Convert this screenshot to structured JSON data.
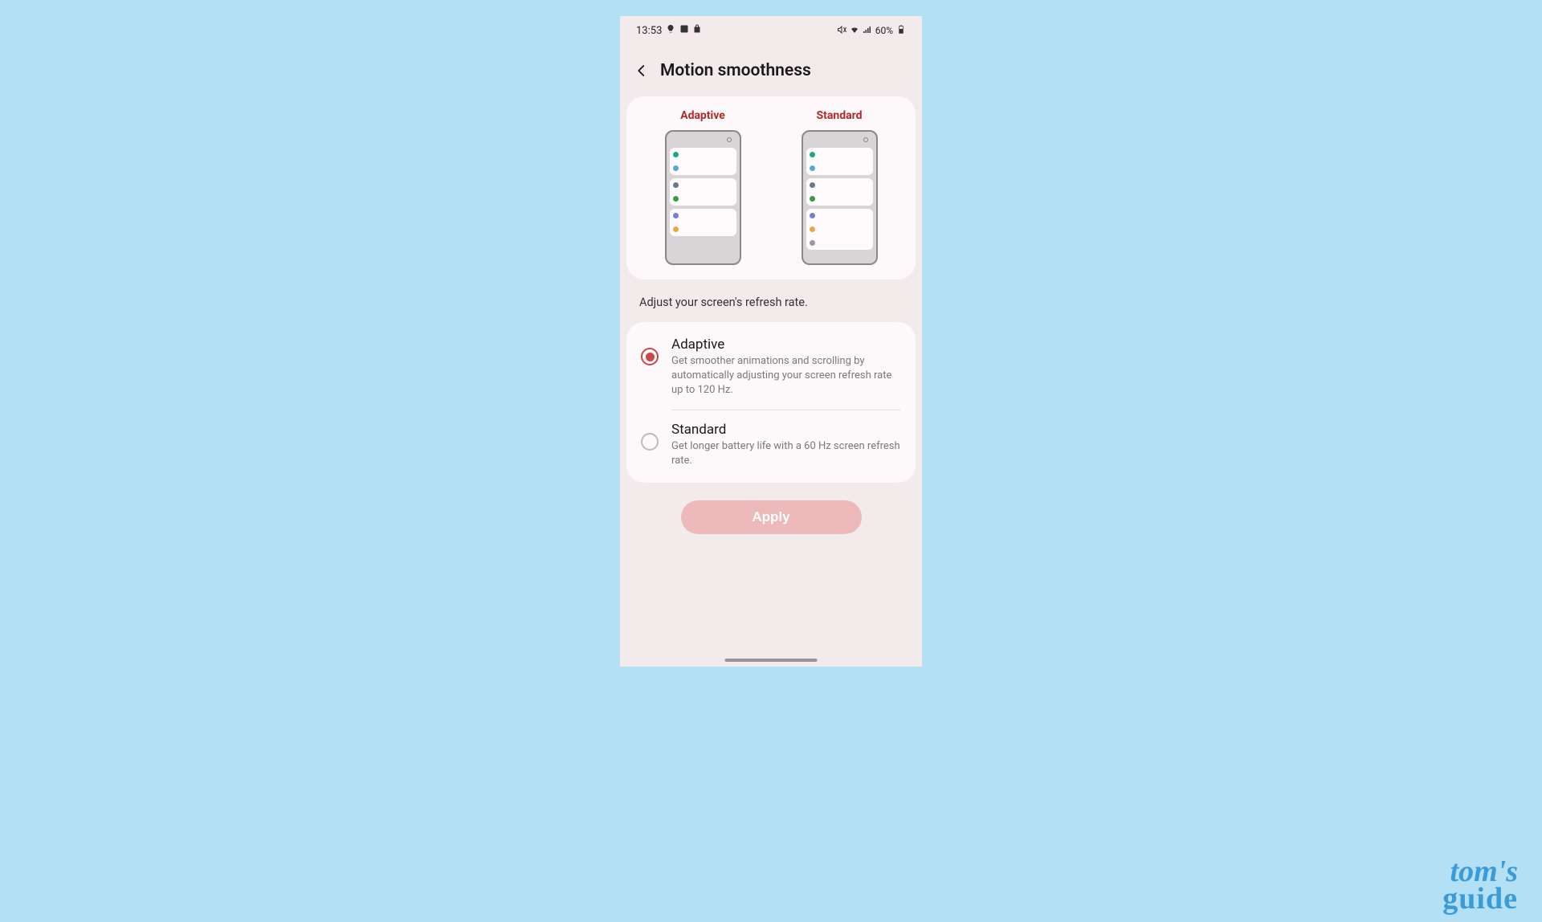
{
  "statusBar": {
    "time": "13:53",
    "battery": "60%"
  },
  "header": {
    "title": "Motion smoothness"
  },
  "preview": {
    "adaptive_label": "Adaptive",
    "standard_label": "Standard"
  },
  "description": "Adjust your screen's refresh rate.",
  "options": {
    "adaptive": {
      "title": "Adaptive",
      "desc": "Get smoother animations and scrolling by automatically adjusting your screen refresh rate up to 120 Hz."
    },
    "standard": {
      "title": "Standard",
      "desc": "Get longer battery life with a 60 Hz screen refresh rate."
    }
  },
  "apply_label": "Apply",
  "watermark": {
    "line1": "tom's",
    "line2": "guide"
  },
  "colors": {
    "accent": "#b02a2a",
    "apply_bg": "#edb9bb"
  }
}
